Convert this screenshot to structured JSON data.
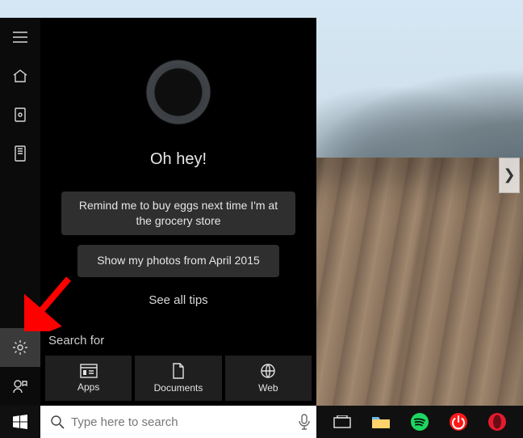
{
  "cortana": {
    "greeting": "Oh hey!",
    "suggestions": [
      "Remind me to buy eggs next time I'm at the grocery store",
      "Show my photos from April 2015"
    ],
    "see_all_tips": "See all tips",
    "search_for_label": "Search for",
    "categories": [
      {
        "id": "apps",
        "label": "Apps"
      },
      {
        "id": "documents",
        "label": "Documents"
      },
      {
        "id": "web",
        "label": "Web"
      }
    ],
    "sidebar_top": [
      {
        "id": "menu",
        "icon": "hamburger-icon"
      },
      {
        "id": "home",
        "icon": "home-icon"
      },
      {
        "id": "notebook",
        "icon": "notebook-icon"
      },
      {
        "id": "devices",
        "icon": "device-icon"
      }
    ],
    "sidebar_bottom": [
      {
        "id": "settings",
        "icon": "gear-icon",
        "active": true
      },
      {
        "id": "feedback",
        "icon": "feedback-icon"
      }
    ]
  },
  "searchbar": {
    "placeholder": "Type here to search",
    "value": ""
  },
  "taskbar": {
    "items": [
      {
        "id": "taskview",
        "icon": "taskview-icon"
      },
      {
        "id": "file-explorer",
        "icon": "folder-icon"
      },
      {
        "id": "spotify",
        "icon": "spotify-icon"
      },
      {
        "id": "power",
        "icon": "power-icon"
      },
      {
        "id": "opera",
        "icon": "opera-icon"
      }
    ]
  },
  "annotation": {
    "arrow_color": "#ff0000"
  }
}
